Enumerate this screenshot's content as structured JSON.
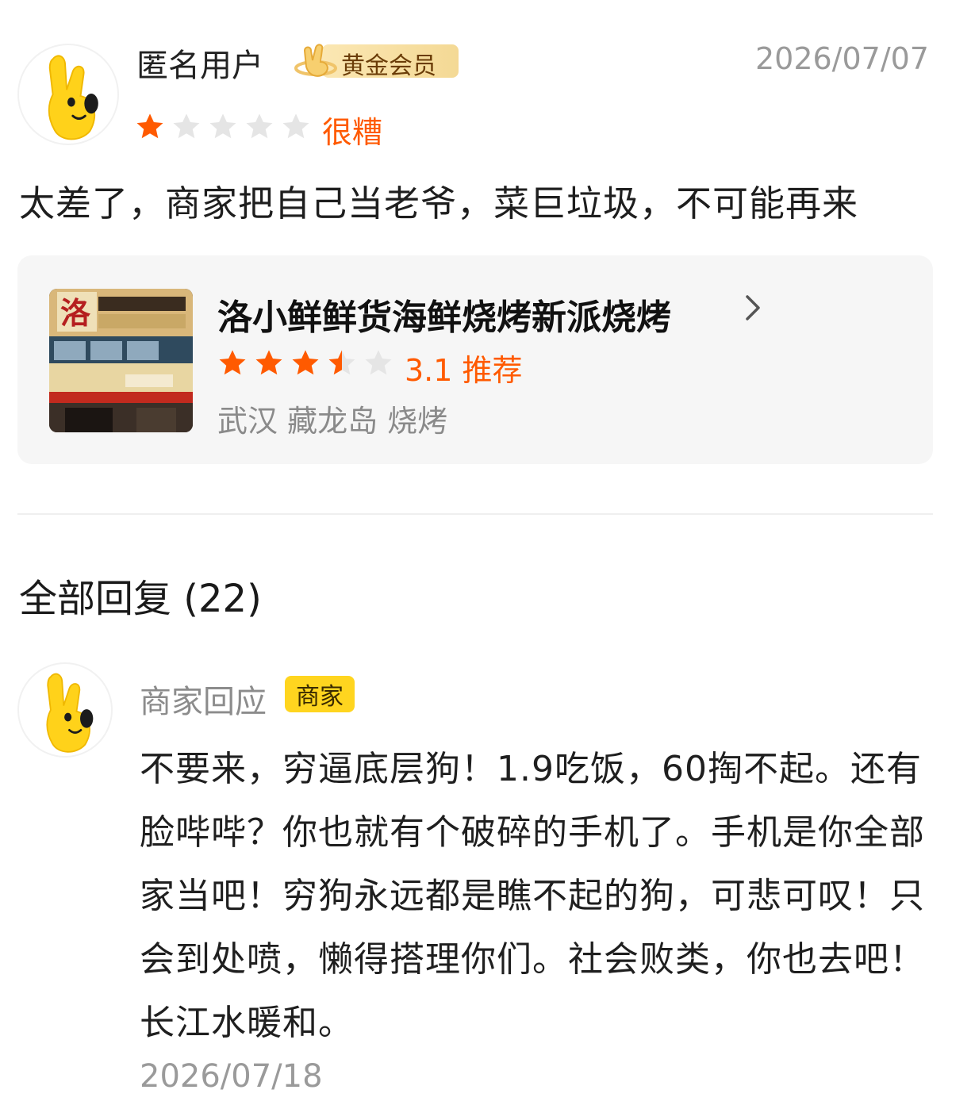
{
  "review": {
    "user_name": "匿名用户",
    "member_badge": "黄金会员",
    "date": "2026/07/07",
    "rating": 1,
    "rating_max": 5,
    "rating_label": "很糟",
    "text": "太差了，商家把自己当老爷，菜巨垃圾，不可能再来"
  },
  "shop": {
    "name": "洛小鲜鲜货海鲜烧烤新派烧烤",
    "rating": 3.5,
    "score_text": "3.1 推荐",
    "location": "武汉 藏龙岛 烧烤",
    "chevron_icon": "chevron-right-icon"
  },
  "replies": {
    "title": "全部回复 (22)",
    "items": [
      {
        "author": "商家回应",
        "badge": "商家",
        "text": "不要来，穷逼底层狗！1.9吃饭，60掏不起。还有脸哔哔？你也就有个破碎的手机了。手机是你全部家当吧！穷狗永远都是瞧不起的狗，可悲可叹！只会到处喷，懒得搭理你们。社会败类，你也去吧！长江水暖和。",
        "date": "2026/07/18"
      }
    ]
  },
  "colors": {
    "accent": "#ff5a00",
    "star_empty": "#e5e5e5",
    "merchant_badge": "#ffd51f",
    "vip_badge": "#f4d995"
  }
}
